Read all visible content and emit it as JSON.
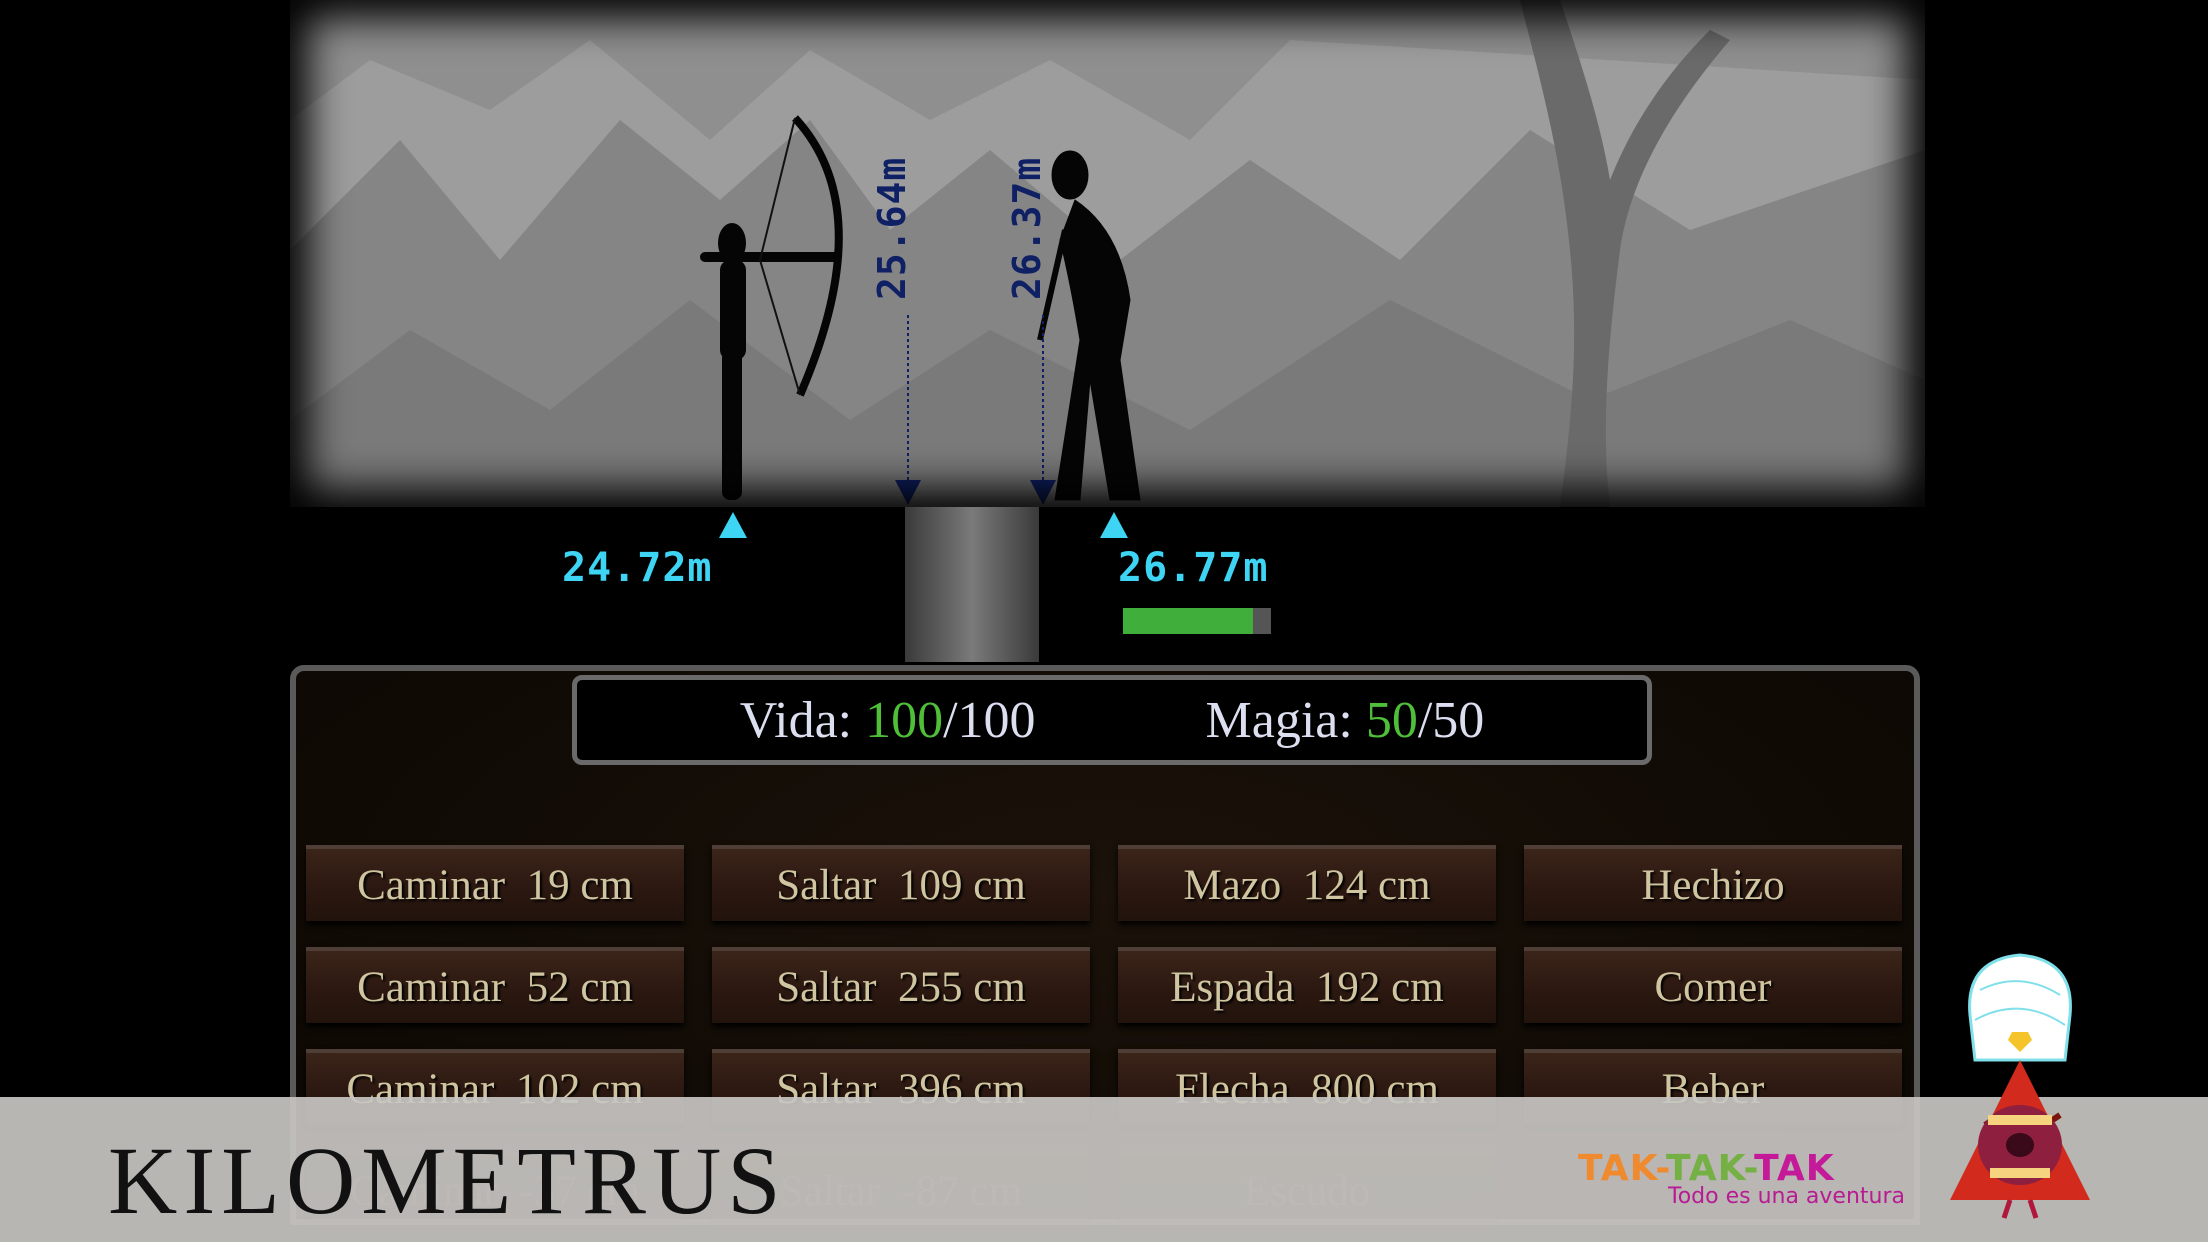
{
  "game": {
    "title": "KILOMETRUS",
    "scene": {
      "archer_arrow_distance": "25.64m",
      "skeleton_arrow_distance": "26.37m",
      "archer_position": "24.72m",
      "skeleton_position": "26.77m",
      "enemy_health_fraction": 0.88
    },
    "stats": {
      "vida_label": "Vida: ",
      "vida_current": "100",
      "vida_max": "/100",
      "magia_label": "Magia: ",
      "magia_current": "50",
      "magia_max": "/50"
    },
    "actions": [
      {
        "label": "Caminar  19 cm"
      },
      {
        "label": "Saltar  109 cm"
      },
      {
        "label": "Mazo  124 cm"
      },
      {
        "label": "Hechizo"
      },
      {
        "label": "Caminar  52 cm"
      },
      {
        "label": "Saltar  255 cm"
      },
      {
        "label": "Espada  192 cm"
      },
      {
        "label": "Comer"
      },
      {
        "label": "Caminar  102 cm"
      },
      {
        "label": "Saltar  396 cm"
      },
      {
        "label": "Flecha  800 cm"
      },
      {
        "label": "Beber"
      },
      {
        "label": "Caminar  -37 cm"
      },
      {
        "label": "Saltar  -87 cm"
      },
      {
        "label": "Escudo"
      },
      {
        "label": ""
      }
    ]
  },
  "branding": {
    "brand_parts": [
      "TAK-",
      "TAK-",
      "TAK"
    ],
    "brand_colors": [
      "#f08a2e",
      "#74b043",
      "#c41a9a"
    ],
    "tagline": "Todo es una aventura"
  },
  "colors": {
    "distance_marker": "#3ed5f5",
    "arrow_marker": "#0f2064",
    "health": "#3fae3a"
  }
}
